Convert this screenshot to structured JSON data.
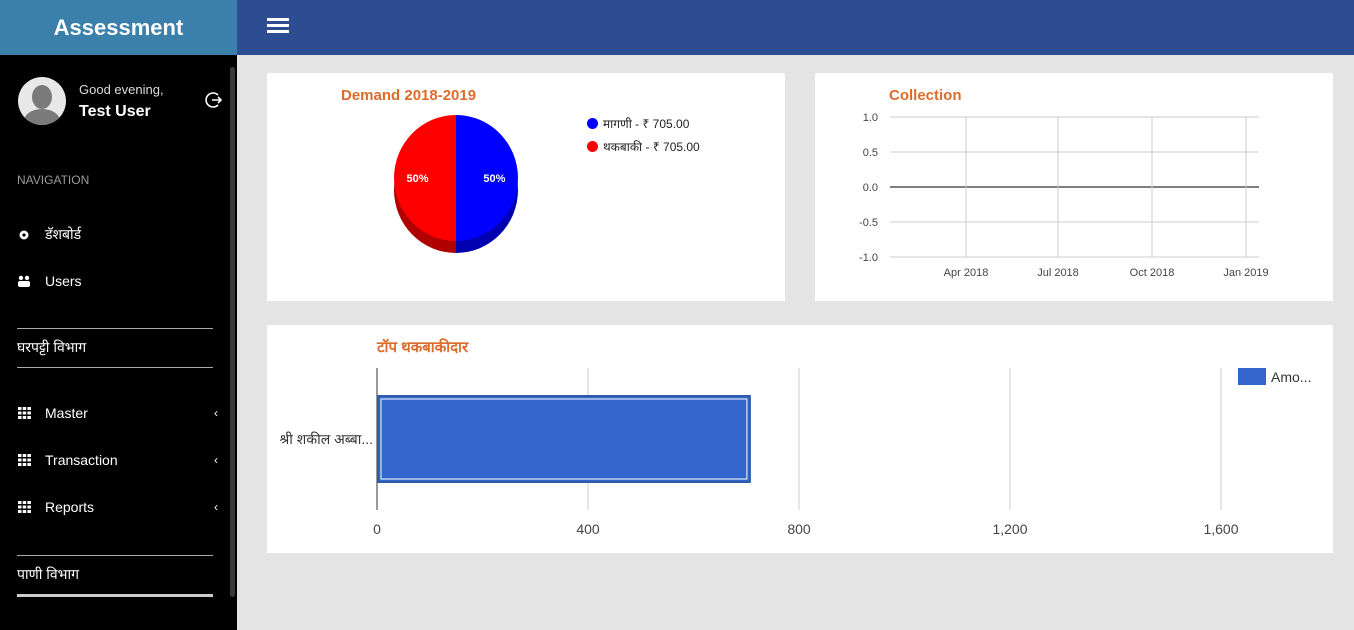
{
  "app": {
    "title": "Assessment"
  },
  "user": {
    "greeting": "Good evening,",
    "name": "Test User"
  },
  "nav": {
    "heading": "NAVIGATION",
    "items": [
      {
        "label": "डॅशबोर्ड",
        "icon": "gear-icon"
      },
      {
        "label": "Users",
        "icon": "users-icon"
      }
    ],
    "section1": "घरपट्टी विभाग",
    "menus": [
      {
        "label": "Master",
        "icon": "grid-icon",
        "chevron": "‹"
      },
      {
        "label": "Transaction",
        "icon": "grid-icon",
        "chevron": "‹"
      },
      {
        "label": "Reports",
        "icon": "grid-icon",
        "chevron": "‹"
      }
    ],
    "section2": "पाणी विभाग"
  },
  "chart_data": [
    {
      "type": "pie",
      "title": "Demand 2018-2019",
      "slices": [
        {
          "label": "मागणी - ₹ 705.00",
          "value": 705,
          "percent": "50%",
          "color": "#0000ff"
        },
        {
          "label": "थकबाकी - ₹ 705.00",
          "value": 705,
          "percent": "50%",
          "color": "#ff0000"
        }
      ],
      "legend": "right"
    },
    {
      "type": "line",
      "title": "Collection",
      "x_ticks": [
        "Apr 2018",
        "Jul 2018",
        "Oct 2018",
        "Jan 2019"
      ],
      "y_ticks": [
        "1.0",
        "0.5",
        "0.0",
        "-0.5",
        "-1.0"
      ],
      "ylim": [
        -1,
        1
      ],
      "series": [],
      "grid": true
    },
    {
      "type": "bar",
      "orientation": "horizontal",
      "title": "टॉप थकबाकीदार",
      "categories": [
        "श्री शकील अब्बा..."
      ],
      "series": [
        {
          "name": "Amo...",
          "values": [
            705
          ],
          "color": "#3366cc"
        }
      ],
      "x_ticks": [
        "0",
        "400",
        "800",
        "1,200",
        "1,600"
      ],
      "xlim": [
        0,
        1700
      ],
      "legend": "top-right"
    }
  ]
}
